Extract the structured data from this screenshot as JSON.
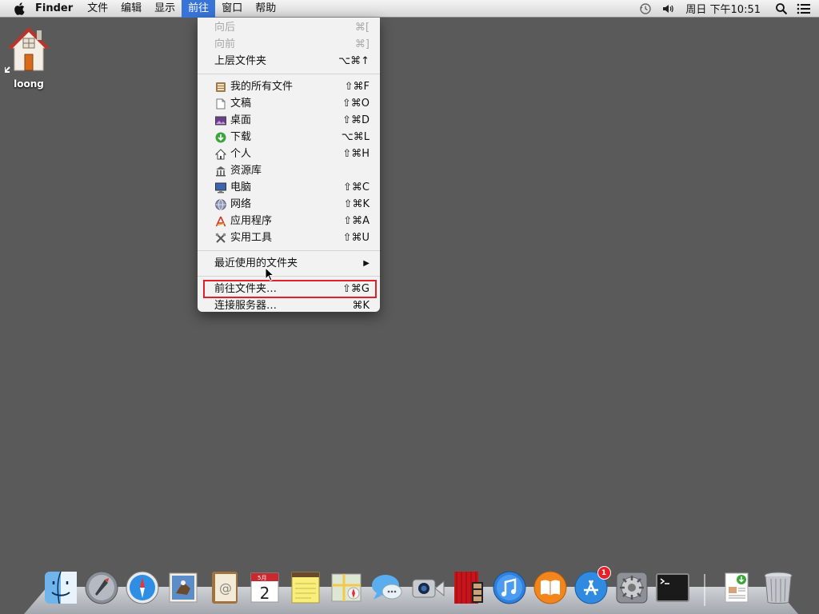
{
  "menubar": {
    "app_name": "Finder",
    "menus": [
      "文件",
      "编辑",
      "显示",
      "前往",
      "窗口",
      "帮助"
    ],
    "active_menu": "前往",
    "clock": "周日 下午10:51"
  },
  "desktop": {
    "icon_label": "loong"
  },
  "go_menu": {
    "back": {
      "label": "向后",
      "shortcut": "⌘["
    },
    "forward": {
      "label": "向前",
      "shortcut": "⌘]"
    },
    "enclosing": {
      "label": "上层文件夹",
      "shortcut": "⌥⌘↑"
    },
    "all_my_files": {
      "label": "我的所有文件",
      "shortcut": "⇧⌘F"
    },
    "documents": {
      "label": "文稿",
      "shortcut": "⇧⌘O"
    },
    "desktop": {
      "label": "桌面",
      "shortcut": "⇧⌘D"
    },
    "downloads": {
      "label": "下载",
      "shortcut": "⌥⌘L"
    },
    "home": {
      "label": "个人",
      "shortcut": "⇧⌘H"
    },
    "library": {
      "label": "资源库",
      "shortcut": ""
    },
    "computer": {
      "label": "电脑",
      "shortcut": "⇧⌘C"
    },
    "network": {
      "label": "网络",
      "shortcut": "⇧⌘K"
    },
    "applications": {
      "label": "应用程序",
      "shortcut": "⇧⌘A"
    },
    "utilities": {
      "label": "实用工具",
      "shortcut": "⇧⌘U"
    },
    "recent_folders": {
      "label": "最近使用的文件夹"
    },
    "go_to_folder": {
      "label": "前往文件夹…",
      "shortcut": "⇧⌘G"
    },
    "connect_server": {
      "label": "连接服务器…",
      "shortcut": "⌘K"
    }
  },
  "dock": {
    "items": [
      "finder-icon",
      "launchpad-icon",
      "safari-icon",
      "mail-icon",
      "contacts-icon",
      "calendar-icon",
      "notes-icon",
      "maps-icon",
      "messages-icon",
      "facetime-icon",
      "photo-booth-icon",
      "itunes-icon",
      "ibooks-icon",
      "app-store-icon",
      "system-preferences-icon",
      "terminal-icon"
    ],
    "calendar_month": "5月",
    "calendar_day": "2",
    "app_store_badge": "1"
  },
  "colors": {
    "desktop": "#5a5a5a",
    "menu_highlight": "#3874d8",
    "annotation_box": "#e0202a"
  }
}
